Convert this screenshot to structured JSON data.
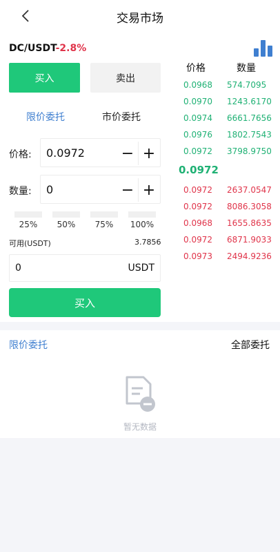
{
  "header": {
    "title": "交易市场",
    "back_icon": "chevron-left-icon"
  },
  "pair": {
    "symbol": "DC/USDT",
    "change": "-2.8%",
    "change_color": "#e0344a",
    "chart_icon": "bar-chart-icon"
  },
  "side_tabs": {
    "buy": "买入",
    "sell": "卖出",
    "active": "buy"
  },
  "order_types": {
    "limit": "限价委托",
    "market": "市价委托",
    "active": "limit"
  },
  "price": {
    "label": "价格:",
    "value": "0.0972",
    "minus": "−",
    "plus": "+"
  },
  "amount": {
    "label": "数量:",
    "value": "0",
    "minus": "−",
    "plus": "+"
  },
  "percents": [
    "25%",
    "50%",
    "75%",
    "100%"
  ],
  "available": {
    "label": "可用(USDT)",
    "value": "3.7856"
  },
  "total": {
    "value": "0",
    "unit": "USDT"
  },
  "submit": {
    "label": "买入"
  },
  "orderbook": {
    "price_header": "价格",
    "qty_header": "数量",
    "buy_color": "#1fb174",
    "sell_color": "#e0344a",
    "bids": [
      {
        "price": "0.0968",
        "qty": "574.7095"
      },
      {
        "price": "0.0970",
        "qty": "1243.6170"
      },
      {
        "price": "0.0974",
        "qty": "6661.7656"
      },
      {
        "price": "0.0976",
        "qty": "1802.7543"
      },
      {
        "price": "0.0972",
        "qty": "3798.9750"
      }
    ],
    "last_price": "0.0972",
    "asks": [
      {
        "price": "0.0972",
        "qty": "2637.0547"
      },
      {
        "price": "0.0972",
        "qty": "8086.3058"
      },
      {
        "price": "0.0968",
        "qty": "1655.8635"
      },
      {
        "price": "0.0972",
        "qty": "6871.9033"
      },
      {
        "price": "0.0973",
        "qty": "2494.9236"
      }
    ]
  },
  "orders": {
    "tab_limit": "限价委托",
    "tab_all": "全部委托",
    "empty_text": "暂无数据",
    "empty_icon": "document-minus-icon"
  },
  "colors": {
    "accent_green": "#1fc87a",
    "accent_blue": "#3f7fd0"
  }
}
